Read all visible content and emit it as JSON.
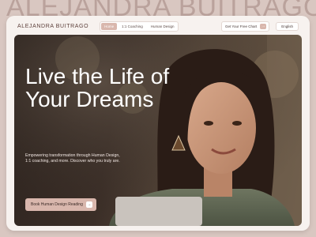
{
  "watermark_text": "ALEJANDRA BUITRAGO",
  "nav": {
    "brand": "ALEJANDRA BUITRAGO",
    "tabs": [
      {
        "label": "Home",
        "active": true
      },
      {
        "label": "1:1 Coaching",
        "active": false
      },
      {
        "label": "Human Design",
        "active": false
      }
    ],
    "cta_label": "Get Your Free Chart",
    "cta_icon": "arrow-right-icon",
    "language_label": "English"
  },
  "hero": {
    "title": "Live the Life of Your Dreams",
    "subtitle": "Empowering transformation through Human Design, 1:1 coaching, and more. Discover who you truly are.",
    "button_label": "Book Human Design Reading",
    "button_icon": "arrow-right-icon"
  },
  "colors": {
    "accent": "#d9b7ad",
    "page_bg": "#d9c7c1",
    "frame_bg": "#f7f2ef",
    "brand_text": "#5c3f3a"
  }
}
